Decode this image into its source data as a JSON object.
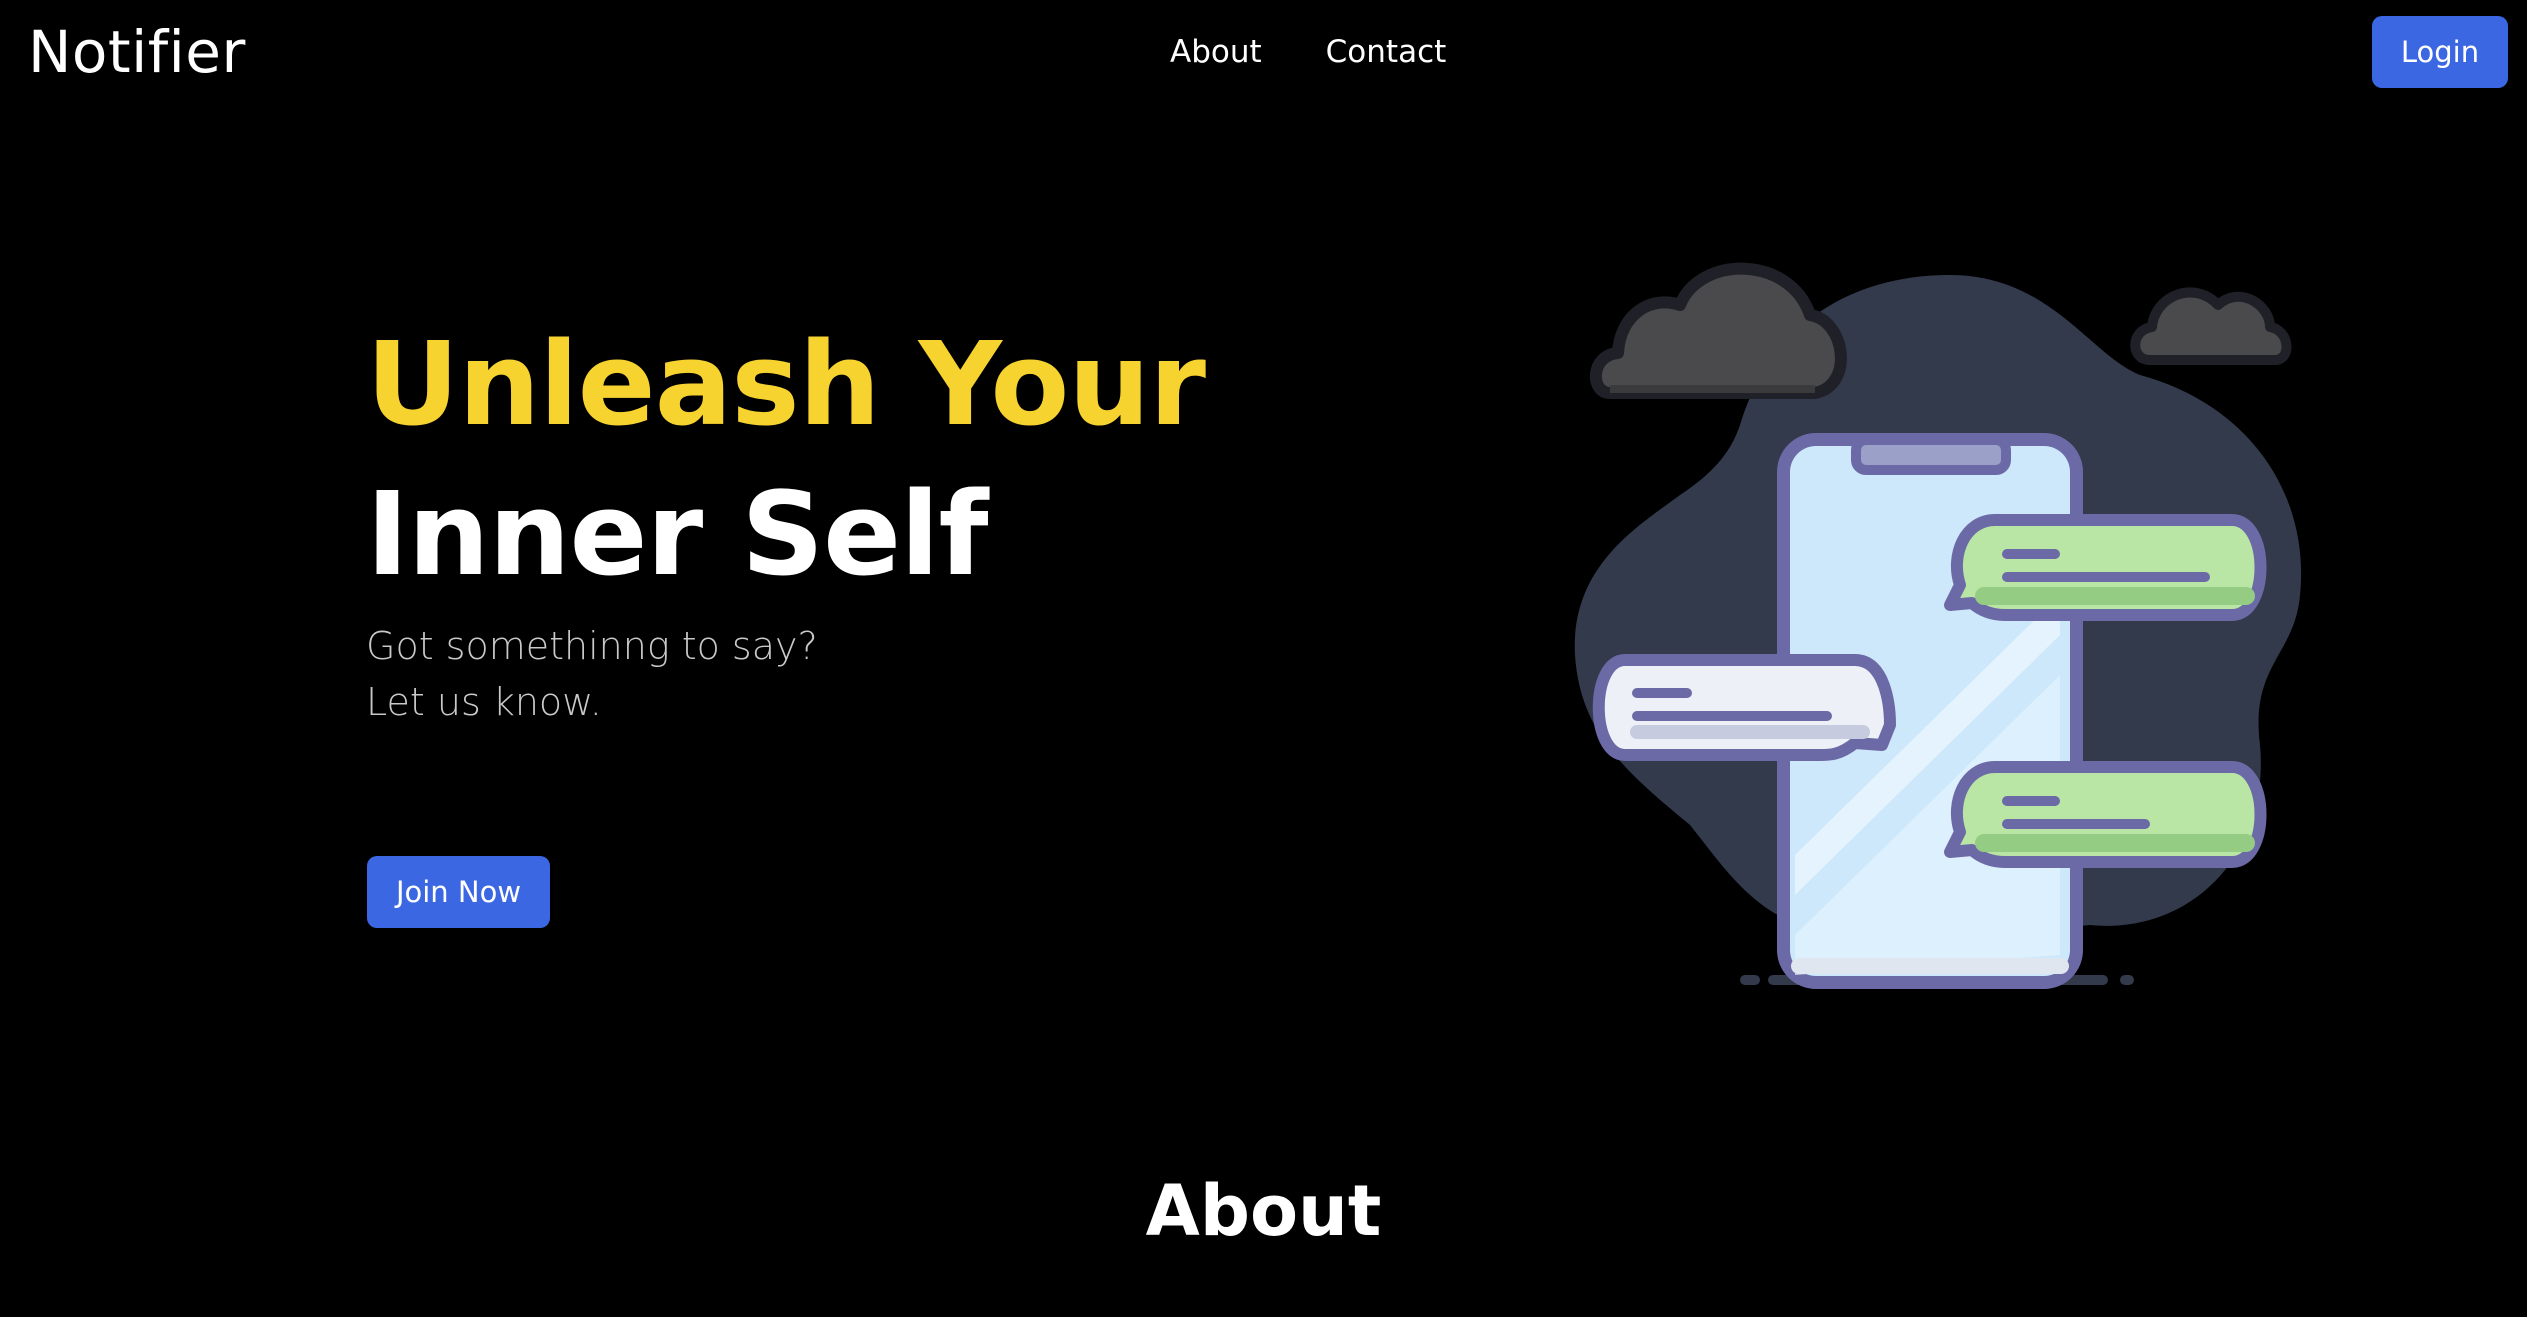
{
  "nav": {
    "brand": "Notifier",
    "links": [
      {
        "label": "About"
      },
      {
        "label": "Contact"
      }
    ],
    "login_label": "Login"
  },
  "hero": {
    "title_line1": "Unleash Your",
    "title_line2": "Inner Self",
    "subtitle_line1": "Got somethinng to say?",
    "subtitle_line2": "Let us know.",
    "cta_label": "Join Now"
  },
  "about": {
    "heading": "About"
  },
  "colors": {
    "background": "#000000",
    "accent_yellow": "#f7d32f",
    "button_blue": "#3c67e3",
    "blob": "#323a4c",
    "phone_outline": "#6c6aa6",
    "bubble_green": "#b9e6a4"
  },
  "illustration": {
    "icon": "phone-chat-illustration"
  }
}
